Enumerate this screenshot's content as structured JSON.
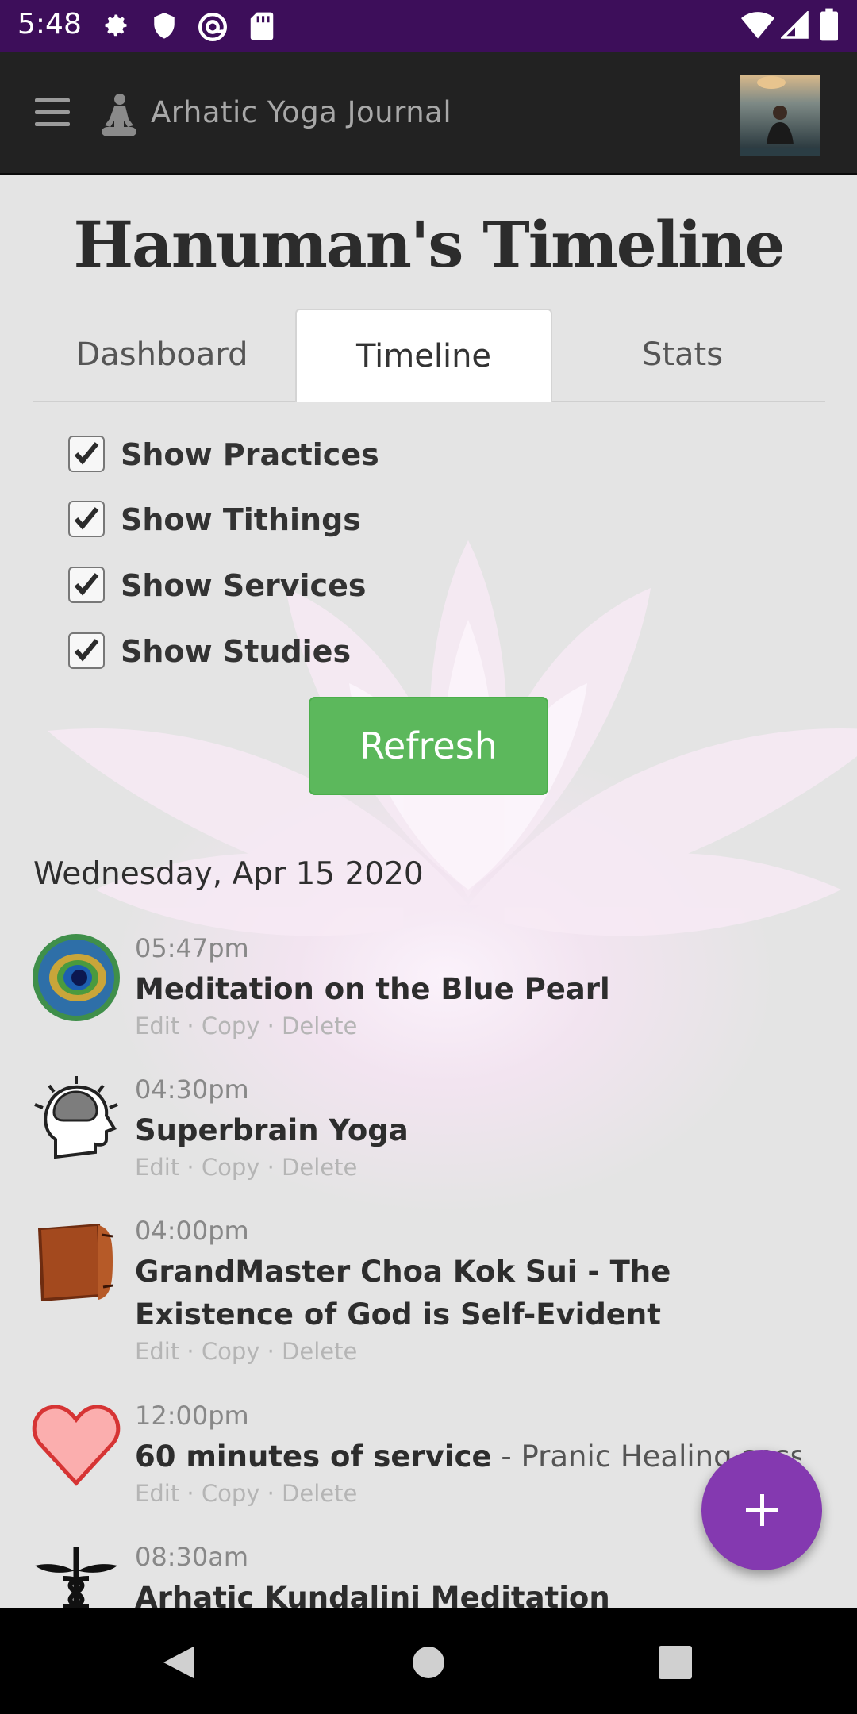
{
  "status_bar": {
    "time": "5:48",
    "left_icons": [
      "settings-icon",
      "shield-icon",
      "at-sign-icon",
      "sd-card-icon"
    ],
    "right_icons": [
      "wifi-icon",
      "cell-signal-icon",
      "battery-icon"
    ]
  },
  "app_bar": {
    "title": "Arhatic Yoga Journal",
    "icons": [
      "menu-icon",
      "meditation-logo-icon"
    ],
    "avatar": "user-avatar"
  },
  "page": {
    "title": "Hanuman's Timeline"
  },
  "tabs": [
    {
      "label": "Dashboard",
      "active": false
    },
    {
      "label": "Timeline",
      "active": true
    },
    {
      "label": "Stats",
      "active": false
    }
  ],
  "filters": [
    {
      "label": "Show Practices",
      "checked": true
    },
    {
      "label": "Show Tithings",
      "checked": true
    },
    {
      "label": "Show Services",
      "checked": true
    },
    {
      "label": "Show Studies",
      "checked": true
    }
  ],
  "refresh_label": "Refresh",
  "timeline": {
    "date": "Wednesday, Apr 15 2020",
    "entries": [
      {
        "time": "05:47pm",
        "title": "Meditation on the Blue Pearl",
        "note": "",
        "icon": "peacock-feather-icon",
        "actions": [
          "Edit",
          "Copy",
          "Delete"
        ]
      },
      {
        "time": "04:30pm",
        "title": "Superbrain Yoga",
        "note": "",
        "icon": "brain-head-icon",
        "actions": [
          "Edit",
          "Copy",
          "Delete"
        ]
      },
      {
        "time": "04:00pm",
        "title": "GrandMaster Choa Kok Sui - The Existence of God is Self-Evident",
        "note": "",
        "icon": "book-icon",
        "actions": [
          "Edit",
          "Copy",
          "Delete"
        ]
      },
      {
        "time": "12:00pm",
        "title": "60 minutes of service",
        "note": " - Pranic Healing session",
        "icon": "heart-icon",
        "actions": [
          "Edit",
          "Copy",
          "Delete"
        ]
      },
      {
        "time": "08:30am",
        "title": "Arhatic Kundalini Meditation",
        "note": "",
        "icon": "caduceus-icon",
        "actions": []
      }
    ]
  },
  "fab": {
    "icon": "plus-icon"
  },
  "nav_bar": {
    "icons": [
      "back-icon",
      "home-icon",
      "recents-icon"
    ]
  },
  "colors": {
    "status_bar": "#3d0e5a",
    "app_bar": "#222222",
    "refresh_button": "#5cb85c",
    "fab": "#8439b0"
  }
}
